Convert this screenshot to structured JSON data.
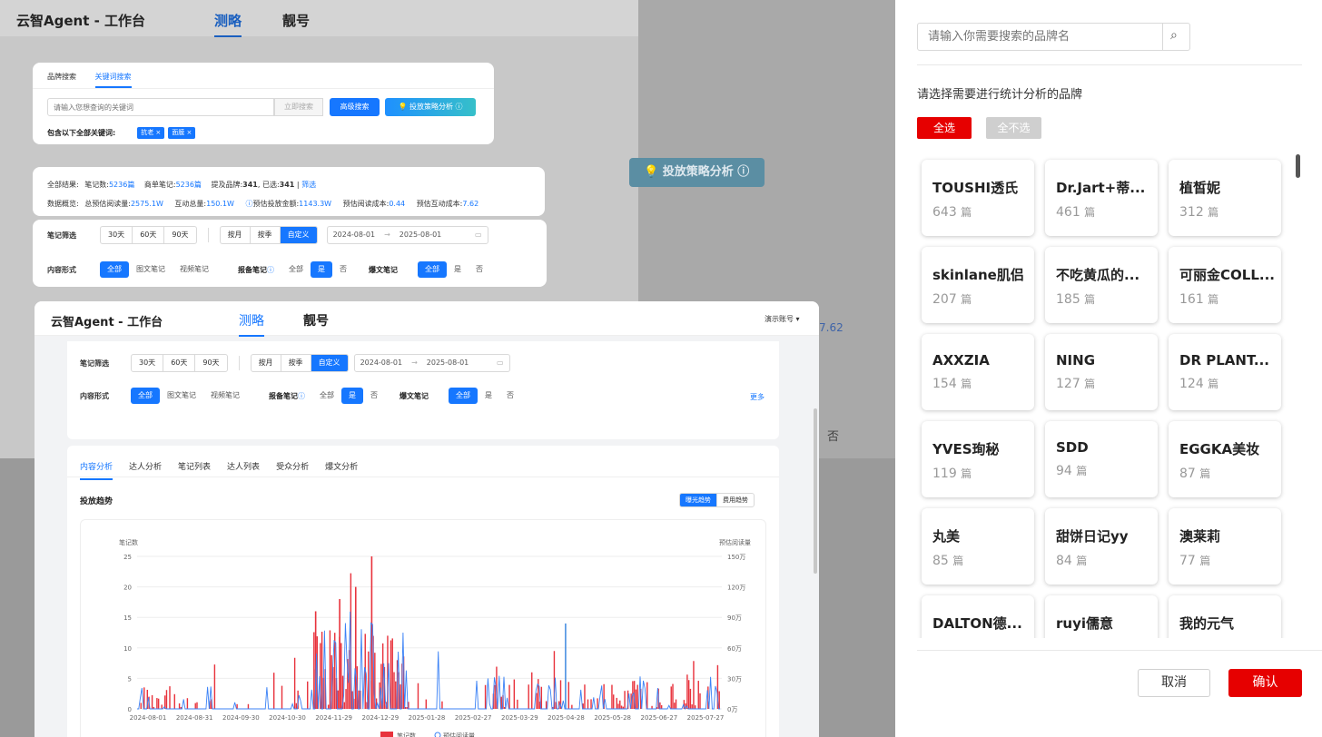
{
  "app": {
    "title": "云智Agent - 工作台",
    "tabs": [
      "测略",
      "靓号"
    ],
    "account": "演示账号"
  },
  "search": {
    "tabs": [
      "品牌搜索",
      "关键词搜索"
    ],
    "placeholder": "请输入您想查询的关键词",
    "btn_now": "立即搜索",
    "btn_adv": "高级搜索",
    "btn_strategy": "投放策略分析",
    "include_label": "包含以下全部关键词:",
    "tags": [
      "抗老 ×",
      "面膜 ×"
    ]
  },
  "summary": {
    "results_label": "全部结果:",
    "notes_label": "笔记数:",
    "notes": "5236篇",
    "biz_label": "商单笔记:",
    "biz": "5236篇",
    "brands_label": "提及品牌:",
    "brands": "341",
    "selected_label": "已选:",
    "selected": "341",
    "filter": "筛选",
    "overview_label": "数据概览:",
    "read_label": "总预估阅读量:",
    "read": "2575.1W",
    "inter_label": "互动总量:",
    "inter": "150.1W",
    "spend_label": "预估投放金额:",
    "spend": "1143.3W",
    "cpr_label": "预估阅读成本:",
    "cpr": "0.44",
    "cpi_label": "预估互动成本:",
    "cpi": "7.62"
  },
  "filters": {
    "note_filter": "笔记筛选",
    "days": [
      "30天",
      "60天",
      "90天"
    ],
    "periods": [
      "按月",
      "按季",
      "自定义"
    ],
    "date_start": "2024-08-01",
    "date_end": "2025-08-01",
    "content_form": "内容形式",
    "content_opts": [
      "全部",
      "图文笔记",
      "视频笔记"
    ],
    "report_label": "报备笔记",
    "report_opts": [
      "全部",
      "是",
      "否"
    ],
    "viral_label": "爆文笔记",
    "viral_opts": [
      "全部",
      "是",
      "否"
    ],
    "more": "更多"
  },
  "analysis": {
    "tabs": [
      "内容分析",
      "达人分析",
      "笔记列表",
      "达人列表",
      "受众分析",
      "爆文分析"
    ],
    "section_title": "投放趋势",
    "toggle": [
      "曝光趋势",
      "费用趋势"
    ]
  },
  "bg_fragments": {
    "strategy": "投放策略分析",
    "value": "7.62",
    "no": "否"
  },
  "chart_data": {
    "type": "bar",
    "ylabel": "笔记数",
    "y2label": "预估阅读量",
    "ylim": [
      0,
      25
    ],
    "yticks": [
      "25",
      "20",
      "15",
      "10",
      "5",
      "0"
    ],
    "y2ticks": [
      "150万",
      "120万",
      "90万",
      "60万",
      "30万",
      "0万"
    ],
    "xticks": [
      "2024-08-01",
      "2024-08-31",
      "2024-09-30",
      "2024-10-30",
      "2024-11-29",
      "2024-12-29",
      "2025-01-28",
      "2025-02-27",
      "2025-03-29",
      "2025-04-28",
      "2025-05-28",
      "2025-06-27",
      "2025-07-27"
    ],
    "legend": [
      "笔记数",
      "预估阅读量"
    ],
    "peaks": [
      {
        "x": "2024-12-25",
        "y": 25
      },
      {
        "x": "2024-12-15",
        "y": 20
      },
      {
        "x": "2024-12-05",
        "y": 18
      },
      {
        "x": "2024-11-20",
        "y": 16
      },
      {
        "x": "2025-04-25",
        "y": 14
      }
    ]
  },
  "brand_panel": {
    "search_placeholder": "请输入你需要搜索的品牌名",
    "prompt": "请选择需要进行统计分析的品牌",
    "select_all": "全选",
    "select_none": "全不选",
    "unit": "篇",
    "cancel": "取消",
    "confirm": "确认",
    "brands": [
      {
        "name": "TOUSHI透氏",
        "count": "643"
      },
      {
        "name": "Dr.Jart+蒂...",
        "count": "461"
      },
      {
        "name": "植皙妮",
        "count": "312"
      },
      {
        "name": "skinlane肌侣",
        "count": "207"
      },
      {
        "name": "不吃黄瓜的...",
        "count": "185"
      },
      {
        "name": "可丽金COLL...",
        "count": "161"
      },
      {
        "name": "AXXZIA",
        "count": "154"
      },
      {
        "name": "NING",
        "count": "127"
      },
      {
        "name": "DR PLANT...",
        "count": "124"
      },
      {
        "name": "YVES珣秘",
        "count": "119"
      },
      {
        "name": "SDD",
        "count": "94"
      },
      {
        "name": "EGGKA美妆",
        "count": "87"
      },
      {
        "name": "丸美",
        "count": "85"
      },
      {
        "name": "甜饼日记yy",
        "count": "84"
      },
      {
        "name": "澳莱莉",
        "count": "77"
      },
      {
        "name": "DALTON德...",
        "count": ""
      },
      {
        "name": "ruyi儒意",
        "count": ""
      },
      {
        "name": "我的元气",
        "count": ""
      }
    ]
  }
}
